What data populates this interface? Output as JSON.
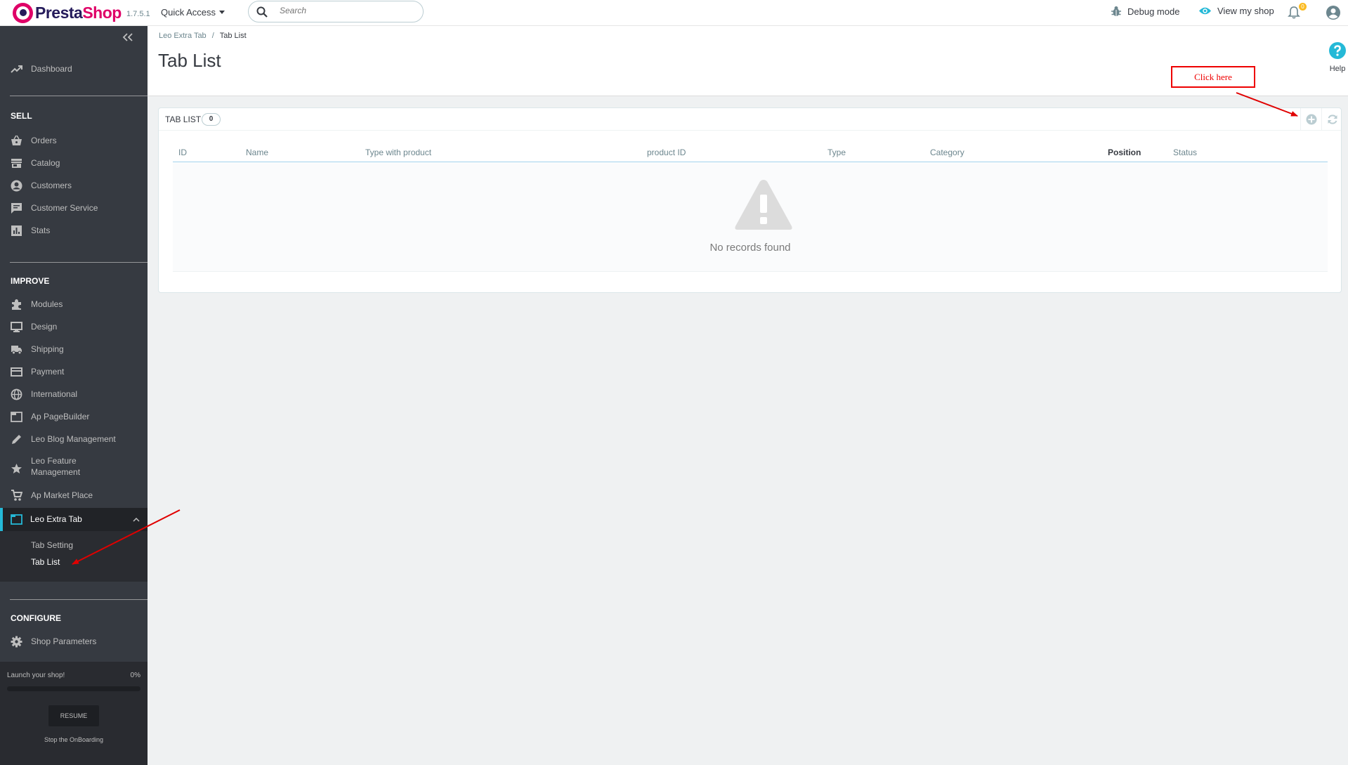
{
  "header": {
    "brand_presta": "Presta",
    "brand_shop": "Shop",
    "version": "1.7.5.1",
    "quick_access": "Quick Access",
    "search_placeholder": "Search",
    "debug_mode": "Debug mode",
    "view_shop": "View my shop",
    "notifications_count": "0"
  },
  "sidebar": {
    "dashboard": "Dashboard",
    "sell_title": "SELL",
    "sell": [
      "Orders",
      "Catalog",
      "Customers",
      "Customer Service",
      "Stats"
    ],
    "improve_title": "IMPROVE",
    "improve": [
      "Modules",
      "Design",
      "Shipping",
      "Payment",
      "International",
      "Ap PageBuilder",
      "Leo Blog Management",
      "Leo Feature Management",
      "Ap Market Place",
      "Leo Extra Tab"
    ],
    "submenu": [
      "Tab Setting",
      "Tab List"
    ],
    "configure_title": "CONFIGURE",
    "configure": [
      "Shop Parameters"
    ],
    "onboarding": {
      "label": "Launch your shop!",
      "percent": "0%",
      "progress": 0,
      "resume": "RESUME",
      "stop": "Stop the OnBoarding"
    }
  },
  "page": {
    "breadcrumb": [
      "Leo Extra Tab",
      "Tab List"
    ],
    "breadcrumb_sep": "/",
    "title": "Tab List",
    "help": "Help"
  },
  "panel": {
    "title": "TAB LIST",
    "count": "0",
    "columns": [
      "ID",
      "Name",
      "Type with product",
      "product ID",
      "Type",
      "Category",
      "Position",
      "Status"
    ],
    "empty_text": "No records found"
  },
  "annotation": {
    "click_here": "Click here",
    "color": "#e00000"
  },
  "colors": {
    "sidebar_bg": "#363a41",
    "accent": "#25b9d7",
    "brand_pink": "#df0067",
    "brand_navy": "#251b5b"
  }
}
